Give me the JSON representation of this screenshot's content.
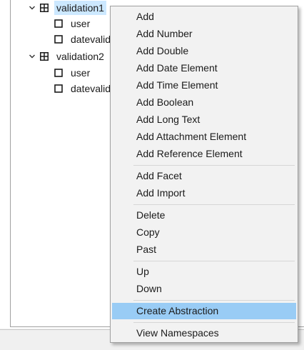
{
  "tree": {
    "nodes": [
      {
        "label": "validation1",
        "selected": true
      },
      {
        "label": "user"
      },
      {
        "label": "datevalidation"
      },
      {
        "label": "validation2",
        "selected": false
      },
      {
        "label": "user"
      },
      {
        "label": "datevalidation"
      }
    ]
  },
  "context_menu": {
    "groups": [
      [
        "Add",
        "Add Number",
        "Add Double",
        "Add Date Element",
        "Add Time Element",
        "Add Boolean",
        "Add Long Text",
        "Add Attachment Element",
        "Add Reference Element"
      ],
      [
        "Add Facet",
        "Add Import"
      ],
      [
        "Delete",
        "Copy",
        "Past"
      ],
      [
        "Up",
        "Down"
      ],
      [
        "Create Abstraction"
      ],
      [
        "View Namespaces"
      ]
    ],
    "highlighted": "Create Abstraction",
    "highlight_color": "#99ccf5"
  },
  "icons": {
    "expanded": "chevron-down-icon",
    "container": "table-grid-icon",
    "leaf": "checkbox-square-icon"
  }
}
